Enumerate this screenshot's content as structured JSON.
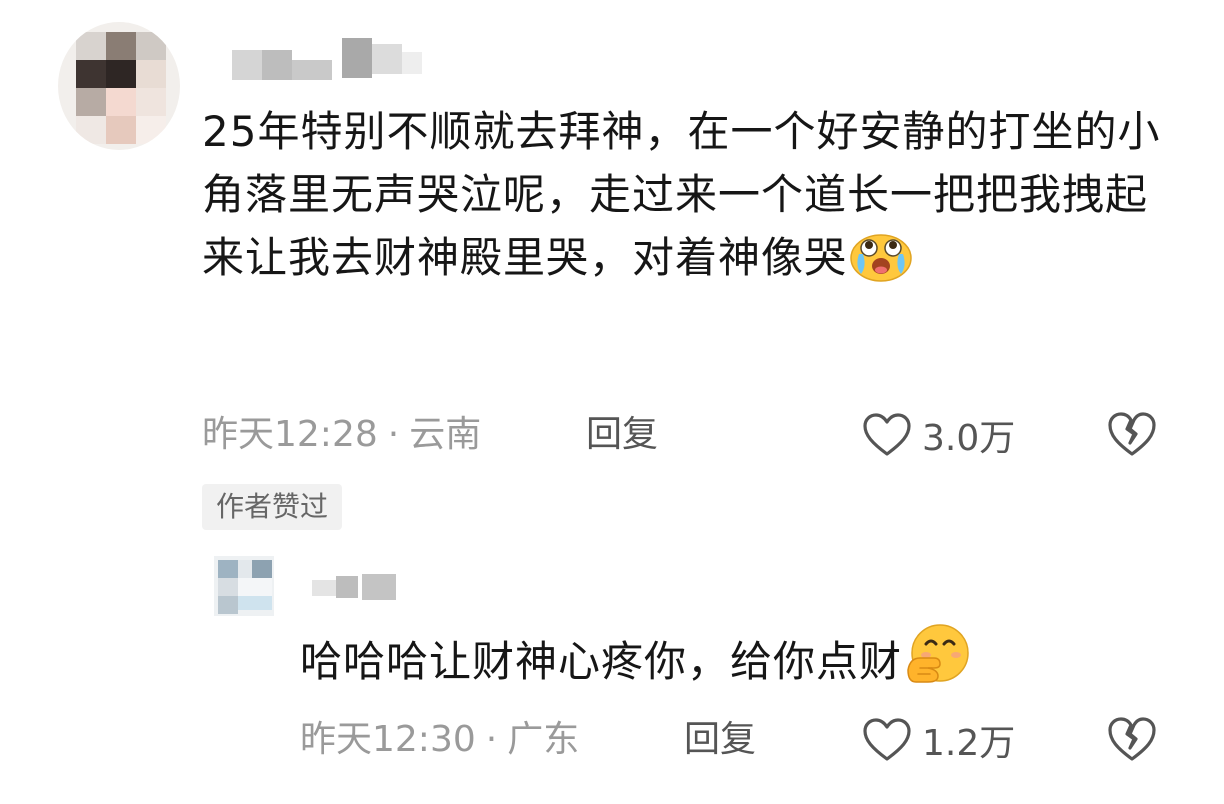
{
  "comment": {
    "text": "25年特别不顺就去拜神，在一个好安静的打坐的小角落里无声哭泣呢，走过来一个道长一把把我拽起来让我去财神殿里哭，对着神像哭",
    "emoji": "crying-face-emoji",
    "time": "昨天12:28",
    "separator": "·",
    "location": "云南",
    "reply_label": "回复",
    "like_count": "3.0万",
    "author_badge": "作者赞过"
  },
  "reply": {
    "text": "哈哈哈让财神心疼你，给你点财",
    "emoji": "hand-over-mouth-emoji",
    "time": "昨天12:30",
    "separator": "·",
    "location": "广东",
    "reply_label": "回复",
    "like_count": "1.2万"
  },
  "icons": {
    "like": "heart-outline-icon",
    "dislike": "broken-heart-icon"
  },
  "colors": {
    "text": "#161616",
    "meta": "#9a9a9a",
    "action": "#555555",
    "badge_bg": "#f1f1f1",
    "emoji_yellow": "#ffc83d"
  }
}
